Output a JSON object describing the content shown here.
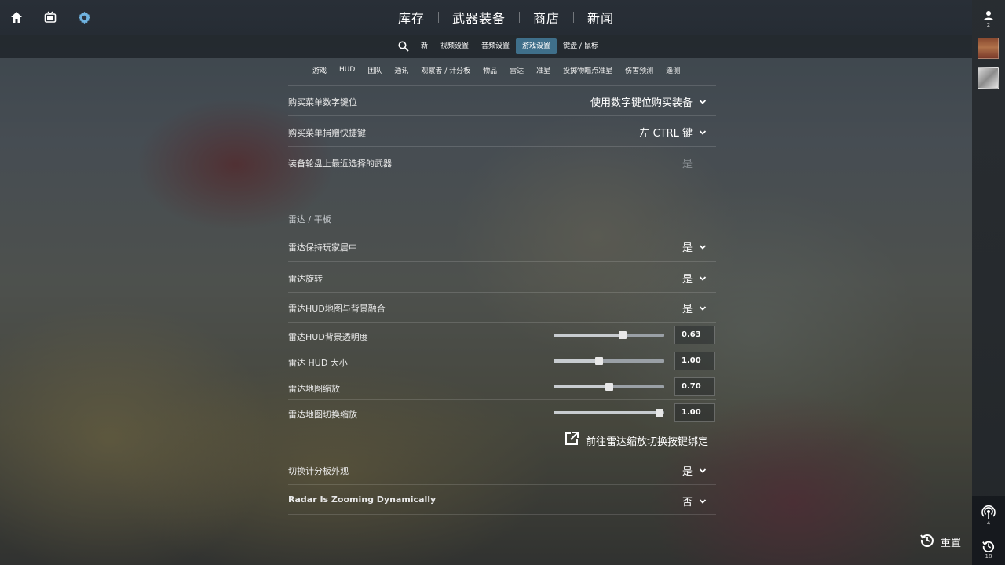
{
  "top_nav": {
    "items": [
      "库存",
      "武器装备",
      "商店",
      "新闻"
    ]
  },
  "sub_tabs": {
    "items": [
      "新",
      "视频设置",
      "音频设置",
      "游戏设置",
      "键盘 / 鼠标"
    ],
    "active_index": 3
  },
  "game_tabs": [
    "游戏",
    "HUD",
    "团队",
    "通讯",
    "观察者 / 计分板",
    "物品",
    "雷达",
    "准星",
    "投掷物瞄点准星",
    "伤害预测",
    "遥测"
  ],
  "settings": {
    "buy_menu_number_keys": {
      "label": "购买菜单数字键位",
      "value": "使用数字键位购买装备"
    },
    "buy_menu_donate_key": {
      "label": "购买菜单捐赠快捷键",
      "value": "左 CTRL 键"
    },
    "wheel_recent_weapon": {
      "label": "装备轮盘上最近选择的武器",
      "value": "是"
    },
    "radar_section_title": "雷达 / 平板",
    "radar_center_player": {
      "label": "雷达保持玩家居中",
      "value": "是"
    },
    "radar_rotate": {
      "label": "雷达旋转",
      "value": "是"
    },
    "radar_blend": {
      "label": "雷达HUD地图与背景融合",
      "value": "是"
    },
    "radar_bg_alpha": {
      "label": "雷达HUD背景透明度",
      "value": "0.63",
      "fraction": 0.62
    },
    "radar_hud_size": {
      "label": "雷达 HUD 大小",
      "value": "1.00",
      "fraction": 0.41
    },
    "radar_map_zoom": {
      "label": "雷达地图缩放",
      "value": "0.70",
      "fraction": 0.5
    },
    "radar_toggle_zoom": {
      "label": "雷达地图切换缩放",
      "value": "1.00",
      "fraction": 0.96
    },
    "radar_zoom_link": "前往雷达缩放切换按键绑定",
    "scoreboard_toggle": {
      "label": "切换计分板外观",
      "value": "是"
    },
    "radar_zoom_dynamic": {
      "label": "Radar Is Zooming Dynamically",
      "value": "否"
    }
  },
  "reset_label": "重置",
  "rail": {
    "friends_count": "2",
    "broadcast_count": "4",
    "history_count": "18"
  },
  "colors": {
    "accent_tab": "#3f6f8a",
    "settings_icon": "#6fb3e0"
  }
}
